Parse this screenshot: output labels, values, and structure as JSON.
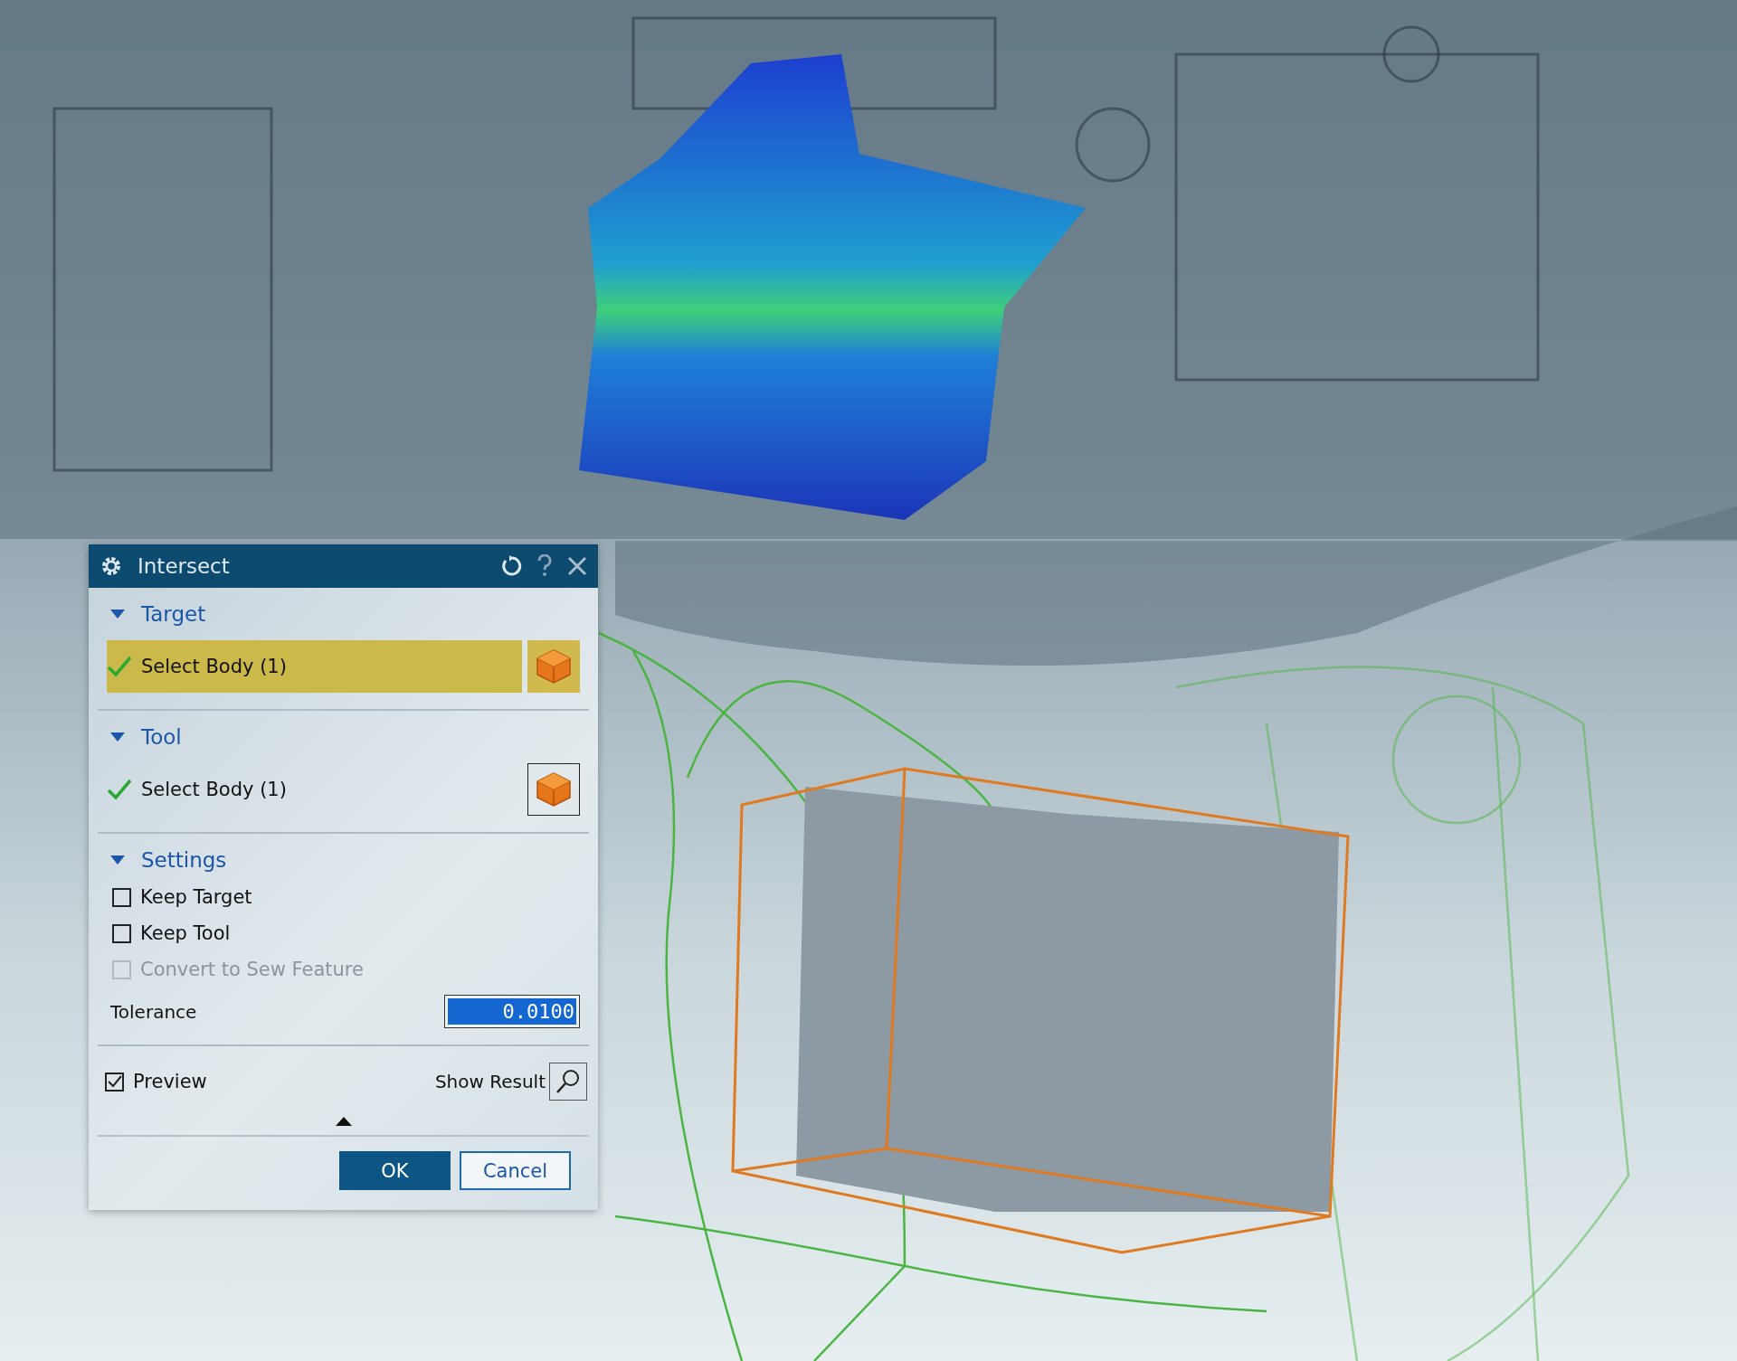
{
  "dialog": {
    "title": "Intersect",
    "sections": [
      {
        "kind": "selection",
        "title": "Target",
        "expanded": true,
        "selection": {
          "label": "Select Body (1)",
          "complete": true,
          "selected": true
        }
      },
      {
        "kind": "selection",
        "title": "Tool",
        "expanded": true,
        "selection": {
          "label": "Select Body (1)",
          "complete": true,
          "selected": false
        }
      },
      {
        "kind": "settings",
        "title": "Settings",
        "expanded": true,
        "options": [
          {
            "label": "Keep Target",
            "checked": false,
            "disabled": false
          },
          {
            "label": "Keep Tool",
            "checked": false,
            "disabled": false
          },
          {
            "label": "Convert to Sew Feature",
            "checked": false,
            "disabled": true
          }
        ],
        "tolerance": {
          "label": "Tolerance",
          "value": "0.0100"
        }
      }
    ],
    "preview": {
      "label": "Preview",
      "checked": true
    },
    "show_result": {
      "label": "Show Result"
    },
    "buttons": [
      {
        "label": "OK",
        "kind": "primary"
      },
      {
        "label": "Cancel",
        "kind": "secondary"
      }
    ]
  }
}
